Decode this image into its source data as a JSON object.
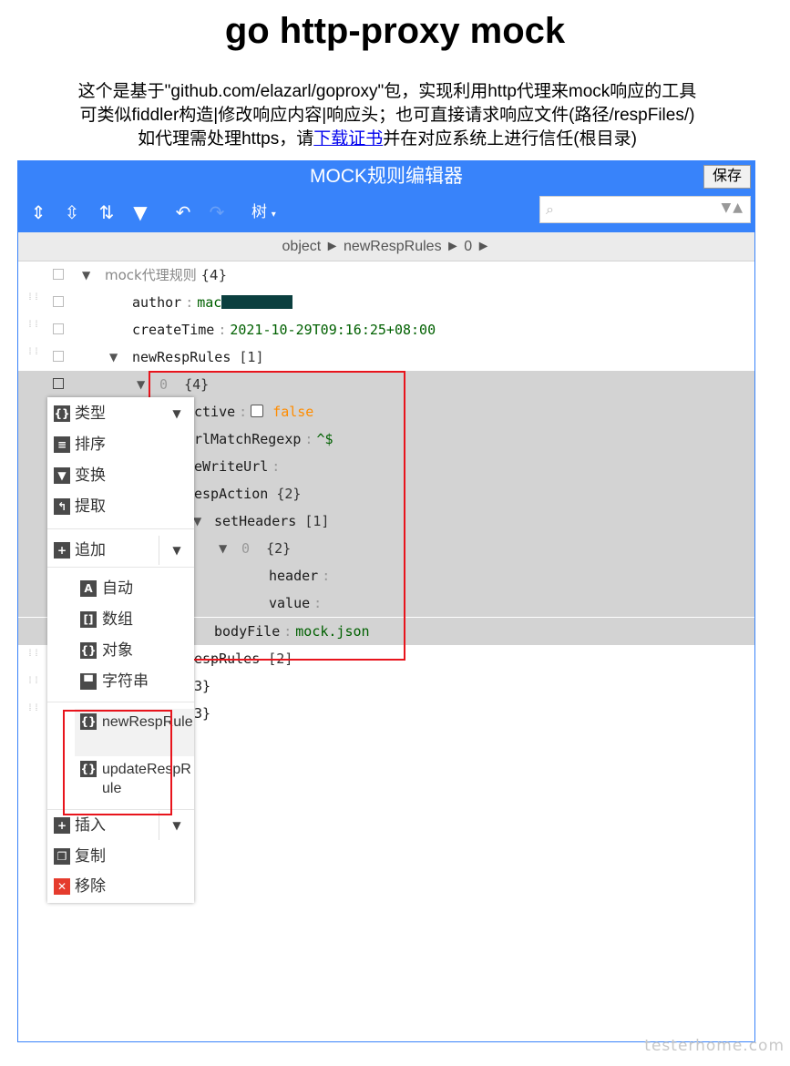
{
  "page": {
    "title": "go http-proxy mock",
    "intro_line1": "这个是基于\"github.com/elazarl/goproxy\"包，实现利用http代理来mock响应的工具",
    "intro_line2": "可类似fiddler构造|修改响应内容|响应头；也可直接请求响应文件(路径/respFiles/)",
    "intro_line3_prefix": "如代理需处理https，请",
    "intro_line3_link": "下载证书",
    "intro_line3_suffix": "并在对应系统上进行信任(根目录)"
  },
  "editor": {
    "header_title": "MOCK规则编辑器",
    "save_label": "保存",
    "toolbar": {
      "expand_all_icon": "expand-all-icon",
      "collapse_all_icon": "collapse-all-icon",
      "sort_icon": "sort-icon",
      "filter_icon": "filter-icon",
      "undo_icon": "undo-icon",
      "redo_icon": "redo-icon",
      "mode_label": "树",
      "search_placeholder": ""
    },
    "navbar": {
      "path": "object ► newRespRules ► 0 ►"
    },
    "tree": {
      "root_name": "mock代理规则",
      "root_count": "{4}",
      "author_key": "author",
      "author_value": "mac",
      "createTime_key": "createTime",
      "createTime_value": "2021-10-29T09:16:25+08:00",
      "newRespRules_key": "newRespRules",
      "newRespRules_count": "[1]",
      "item0_index": "0",
      "item0_count": "{4}",
      "active_key": "ctive",
      "active_value": "false",
      "urlMatchRegexp_key": "rlMatchRegexp",
      "urlMatchRegexp_value": "^$",
      "reWriteUrl_key": "eWriteUrl",
      "respAction_key": "espAction",
      "respAction_count": "{2}",
      "setHeaders_key": "setHeaders",
      "setHeaders_count": "[1]",
      "setHeaders0_index": "0",
      "setHeaders0_count": "{2}",
      "header_key": "header",
      "value_key": "value",
      "bodyFile_key": "bodyFile",
      "bodyFile_value": "mock.json",
      "updateRespRules_key": "espRules",
      "updateRespRules_count": "[2]",
      "tail1": "3}",
      "tail2": "3}"
    }
  },
  "context_menu": {
    "type_label": "类型",
    "sort_label": "排序",
    "transform_label": "变换",
    "extract_label": "提取",
    "append_label": "追加",
    "auto_label": "自动",
    "array_label": "数组",
    "object_label": "对象",
    "string_label": "字符串",
    "template1_label": "newRespRule",
    "template2_label": "updateRespRule",
    "insert_label": "插入",
    "duplicate_label": "复制",
    "remove_label": "移除"
  },
  "colors": {
    "accent": "#3883fa",
    "highlight_border": "#e8141c",
    "string_value": "#006000",
    "bool_value": "#ff8c00"
  },
  "watermark": "testerhome.com"
}
